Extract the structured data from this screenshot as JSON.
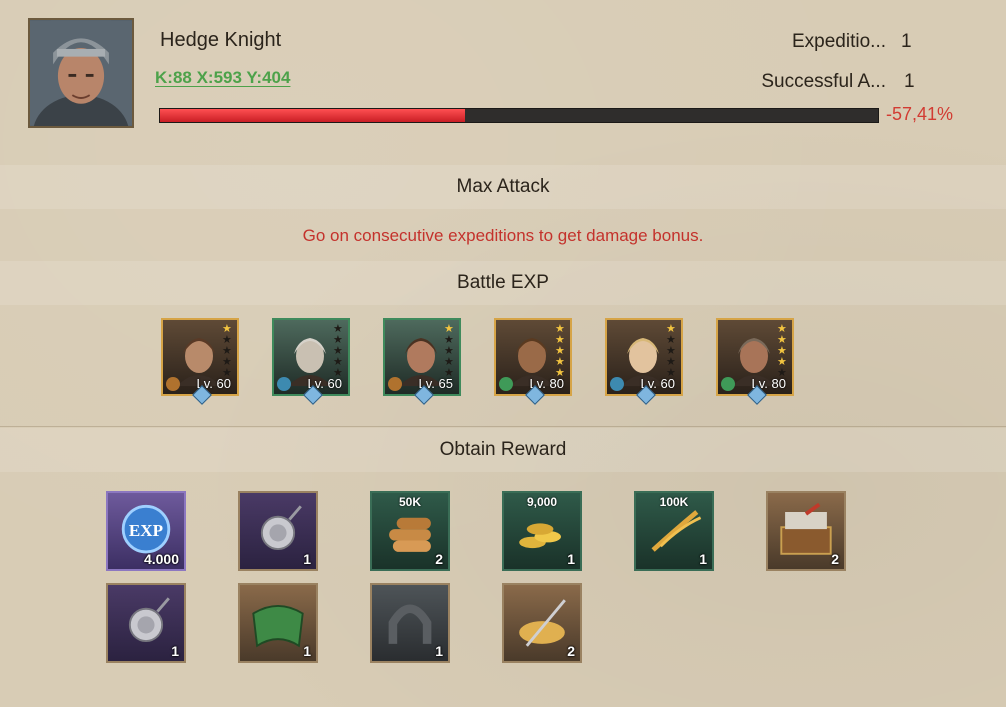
{
  "player": {
    "name": "Hedge Knight",
    "coords": "K:88 X:593 Y:404",
    "stats": [
      {
        "label": "Expeditio...",
        "value": "1"
      },
      {
        "label": "Successful A...",
        "value": "1"
      }
    ],
    "progress_fraction": 0.425,
    "progress_text": "-57,41%"
  },
  "sections": {
    "max_attack": "Max Attack",
    "hint": "Go on consecutive expeditions to get damage bonus.",
    "battle_exp": "Battle EXP",
    "obtain_reward": "Obtain Reward"
  },
  "heroes": [
    {
      "level": "Lv. 60",
      "frame": "gold",
      "class": "sword",
      "stars": 1
    },
    {
      "level": "Lv. 60",
      "frame": "green",
      "class": "horse",
      "stars": 0
    },
    {
      "level": "Lv. 65",
      "frame": "green",
      "class": "sword",
      "stars": 1
    },
    {
      "level": "Lv. 80",
      "frame": "gold",
      "class": "leaf",
      "stars": 5
    },
    {
      "level": "Lv. 60",
      "frame": "gold",
      "class": "horse",
      "stars": 1
    },
    {
      "level": "Lv. 80",
      "frame": "gold",
      "class": "leaf",
      "stars": 4
    }
  ],
  "rewards": [
    {
      "icon": "exp-orb-icon",
      "top": "",
      "count": "4.000"
    },
    {
      "icon": "silver-rose-icon",
      "top": "",
      "count": "1"
    },
    {
      "icon": "wood-logs-icon",
      "top": "50K",
      "count": "2"
    },
    {
      "icon": "gold-coins-icon",
      "top": "9,000",
      "count": "1"
    },
    {
      "icon": "wheat-icon",
      "top": "100K",
      "count": "1"
    },
    {
      "icon": "treasure-chest-icon",
      "top": "",
      "count": "2"
    },
    {
      "icon": "silver-rose-icon",
      "top": "",
      "count": "1"
    },
    {
      "icon": "green-cloth-icon",
      "top": "",
      "count": "1"
    },
    {
      "icon": "horseshoe-icon",
      "top": "",
      "count": "1"
    },
    {
      "icon": "quill-icon",
      "top": "",
      "count": "2"
    }
  ],
  "colors": {
    "accent_red": "#d23b32",
    "coords_green": "#4da24a",
    "hero_gold": "#d6a447",
    "hero_green": "#3f8a5c"
  }
}
